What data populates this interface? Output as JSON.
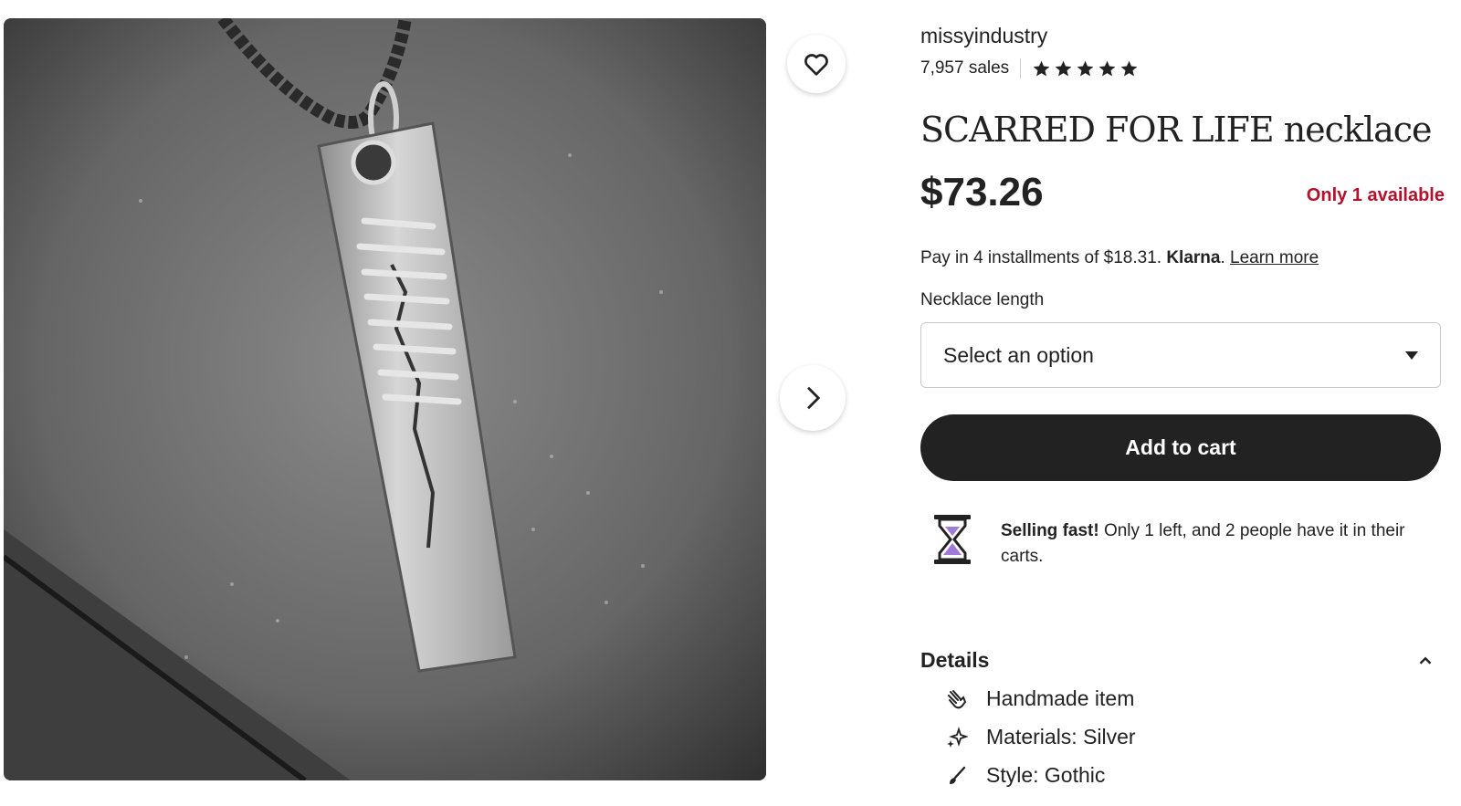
{
  "shop": {
    "name": "missyindustry",
    "sales": "7,957 sales",
    "rating_stars": 5
  },
  "product": {
    "title": "SCARRED FOR LIFE necklace",
    "price": "$73.26",
    "availability": "Only 1 available"
  },
  "payment": {
    "prefix": "Pay in 4 installments of $18.31. ",
    "provider": "Klarna",
    "suffix": ". ",
    "learn_more": "Learn more"
  },
  "option": {
    "label": "Necklace length",
    "selected": "Select an option"
  },
  "cart": {
    "button_label": "Add to cart"
  },
  "urgency": {
    "headline": "Selling fast!",
    "message": " Only 1 left, and 2 people have it in their carts."
  },
  "details": {
    "heading": "Details",
    "items": [
      {
        "icon": "hand-icon",
        "label": "Handmade item"
      },
      {
        "icon": "sparkle-icon",
        "label": "Materials: Silver"
      },
      {
        "icon": "brush-icon",
        "label": "Style: Gothic"
      }
    ]
  },
  "icons": {
    "favorite": "heart-icon",
    "next": "chevron-right-icon",
    "select": "caret-down-icon",
    "urgency": "hourglass-icon",
    "collapse": "chevron-up-icon"
  },
  "colors": {
    "availability": "#b3102b",
    "button": "#222222",
    "hourglass_sand": "#a07bd9"
  }
}
